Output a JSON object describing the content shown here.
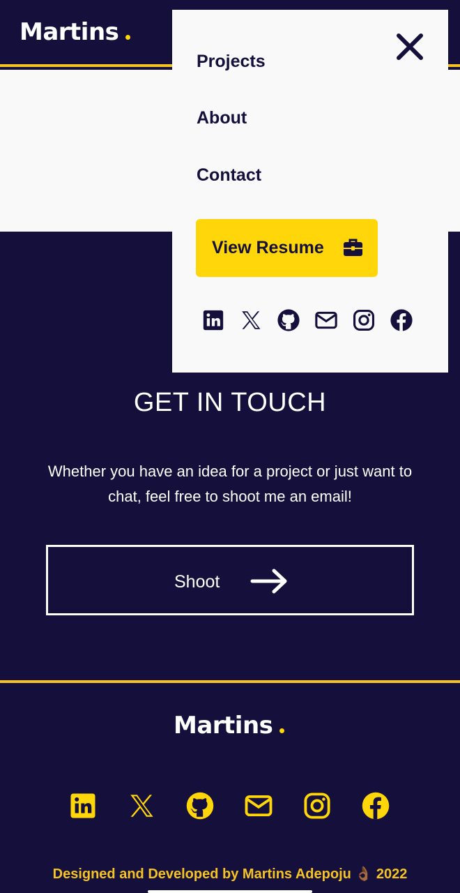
{
  "brand": {
    "logo_text": "Martins"
  },
  "colors": {
    "navy": "#140f3b",
    "accent": "#ffd60a",
    "panel": "#f9f9f9",
    "white": "#ffffff"
  },
  "menu": {
    "items": [
      {
        "label": "Projects"
      },
      {
        "label": "About"
      },
      {
        "label": "Contact"
      }
    ],
    "resume_label": "View Resume",
    "close_icon": "close-icon",
    "social_icons": [
      "linkedin-icon",
      "x-icon",
      "github-icon",
      "mail-icon",
      "instagram-icon",
      "facebook-icon"
    ]
  },
  "contact": {
    "title": "GET IN TOUCH",
    "text": "Whether you have an idea for a project or just want to chat, feel free to shoot me an email!",
    "button_label": "Shoot"
  },
  "footer": {
    "logo_text": "Martins",
    "social_icons": [
      "linkedin-icon",
      "x-icon",
      "github-icon",
      "mail-icon",
      "instagram-icon",
      "facebook-icon"
    ],
    "credit": "Designed and Developed by Martins Adepoju 👌🏾 2022"
  }
}
